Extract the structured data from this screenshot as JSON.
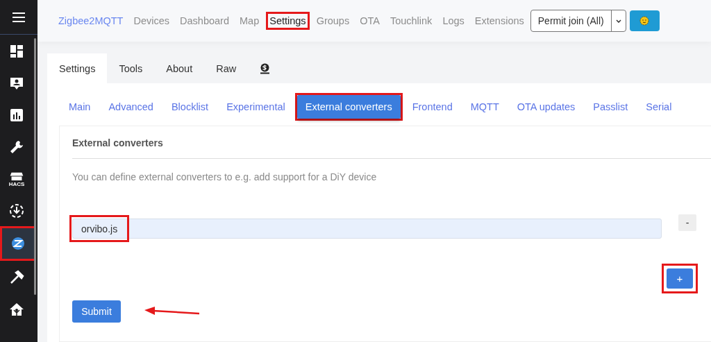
{
  "sidebar": {
    "items": [
      {
        "selected": false,
        "annotated": false
      },
      {
        "selected": false,
        "annotated": false
      },
      {
        "selected": false,
        "annotated": false
      },
      {
        "selected": false,
        "annotated": false
      },
      {
        "selected": false,
        "annotated": false,
        "caption": "HACS"
      },
      {
        "selected": false,
        "annotated": false
      },
      {
        "selected": true,
        "annotated": true
      },
      {
        "selected": false,
        "annotated": false
      },
      {
        "selected": false,
        "annotated": false
      }
    ]
  },
  "topnav": {
    "brand": "Zigbee2MQTT",
    "links": [
      {
        "label": "Devices",
        "selected": false,
        "annotated": false
      },
      {
        "label": "Dashboard",
        "selected": false,
        "annotated": false
      },
      {
        "label": "Map",
        "selected": false,
        "annotated": false
      },
      {
        "label": "Settings",
        "selected": true,
        "annotated": true
      },
      {
        "label": "Groups",
        "selected": false,
        "annotated": false
      },
      {
        "label": "OTA",
        "selected": false,
        "annotated": false
      },
      {
        "label": "Touchlink",
        "selected": false,
        "annotated": false
      },
      {
        "label": "Logs",
        "selected": false,
        "annotated": false
      },
      {
        "label": "Extensions",
        "selected": false,
        "annotated": false
      }
    ],
    "permit_join": "Permit join (All)"
  },
  "tabs": [
    {
      "kind": "text",
      "label": "Settings",
      "selected": true
    },
    {
      "kind": "text",
      "label": "Tools",
      "selected": false
    },
    {
      "kind": "text",
      "label": "About",
      "selected": false
    },
    {
      "kind": "text",
      "label": "Raw",
      "selected": false
    },
    {
      "kind": "icon",
      "selected": false
    }
  ],
  "subtabs": [
    {
      "label": "Main",
      "selected": false,
      "annotated": false
    },
    {
      "label": "Advanced",
      "selected": false,
      "annotated": false
    },
    {
      "label": "Blocklist",
      "selected": false,
      "annotated": false
    },
    {
      "label": "Experimental",
      "selected": false,
      "annotated": false
    },
    {
      "label": "External converters",
      "selected": true,
      "annotated": true
    },
    {
      "label": "Frontend",
      "selected": false,
      "annotated": false
    },
    {
      "label": "MQTT",
      "selected": false,
      "annotated": false
    },
    {
      "label": "OTA updates",
      "selected": false,
      "annotated": false
    },
    {
      "label": "Passlist",
      "selected": false,
      "annotated": false
    },
    {
      "label": "Serial",
      "selected": false,
      "annotated": false
    }
  ],
  "section": {
    "title": "External converters",
    "description": "You can define external converters to e.g. add support for a DiY device",
    "converters": [
      {
        "value": "orvibo.js",
        "annotated": true
      }
    ],
    "remove_label": "-",
    "add_label": "+",
    "add_annotated": true,
    "submit": "Submit",
    "arrow_to_submit": true
  }
}
